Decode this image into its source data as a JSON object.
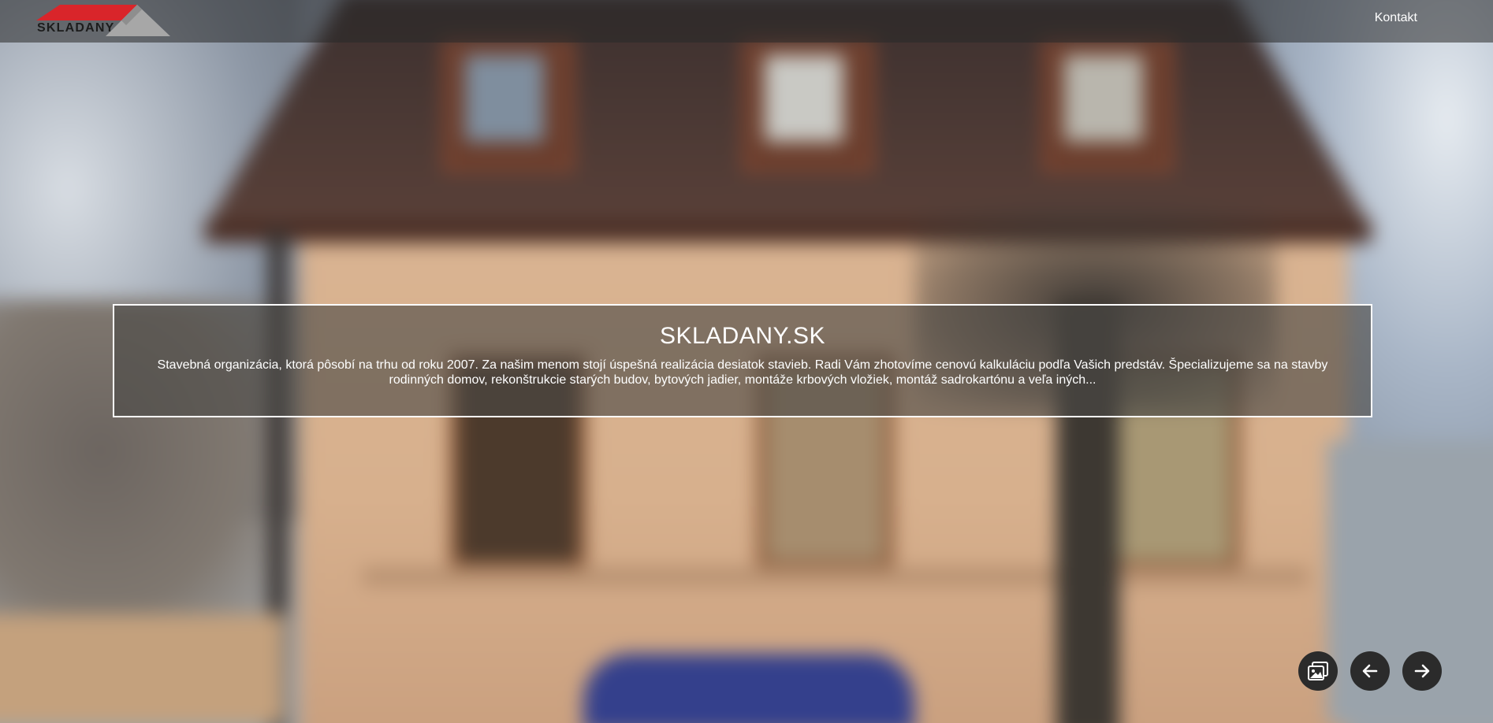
{
  "header": {
    "logo": {
      "text": "SKLADANY",
      "colors": {
        "roof_red": "#d9252a",
        "roof_gray": "#a7a7a7"
      }
    },
    "nav": [
      {
        "label": "Kontakt"
      }
    ]
  },
  "hero": {
    "title": "SKLADANY.SK",
    "description": "Stavebná organizácia, ktorá pôsobí na trhu od roku 2007. Za našim menom stojí úspešná realizácia desiatok stavieb. Radi Vám zhotovíme cenovú kalkuláciu podľa Vašich predstáv. Špecializujeme sa na stavby rodinných domov, rekonštrukcie starých budov, bytových jadier, montáže krbových vložiek, montáž sadrokartónu a veľa iných..."
  },
  "slider_controls": {
    "gallery_icon": "image-gallery-icon",
    "prev_icon": "arrow-left-icon",
    "next_icon": "arrow-right-icon"
  }
}
